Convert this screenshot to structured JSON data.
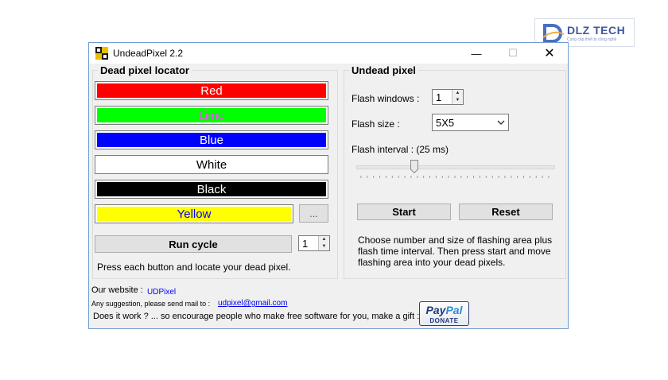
{
  "watermark": {
    "brand": "DLZ TECH",
    "tagline": "Cung cấp thiết bị công nghệ"
  },
  "window": {
    "title": "UndeadPixel 2.2",
    "minimize": "—",
    "maximize": "☐",
    "close": "✕"
  },
  "locator": {
    "group_title": "Dead pixel locator",
    "colors": [
      {
        "label": "Red",
        "bg": "#ff0000",
        "fg": "#ffffff"
      },
      {
        "label": "Lime",
        "bg": "#00ff00",
        "fg": "#ff44ff"
      },
      {
        "label": "Blue",
        "bg": "#0000ff",
        "fg": "#ffffff"
      },
      {
        "label": "White",
        "bg": "#ffffff",
        "fg": "#000000"
      },
      {
        "label": "Black",
        "bg": "#000000",
        "fg": "#ffffff"
      },
      {
        "label": "Yellow",
        "bg": "#ffff00",
        "fg": "#0000ff"
      }
    ],
    "custom_color_button": "...",
    "run_cycle_button": "Run cycle",
    "cycle_count": "1",
    "hint": "Press each button and locate your dead pixel."
  },
  "undead": {
    "group_title": "Undead pixel",
    "flash_windows_label": "Flash windows :",
    "flash_windows_value": "1",
    "flash_size_label": "Flash size :",
    "flash_size_value": "5X5",
    "flash_interval_label": "Flash interval : (25 ms)",
    "flash_interval_level": 0.29,
    "start_button": "Start",
    "reset_button": "Reset",
    "description_lines": [
      "Choose number and size of flashing area plus",
      "flash time interval. Then press start and move",
      "flashing area into your dead pixels."
    ]
  },
  "footer": {
    "website_label": "Our website :",
    "website_link": "UDPixel",
    "mail_label": "Any suggestion, please send mail to :",
    "mail_link": "udpixel@gmail.com",
    "gift_text": "Does it work ? ... so encourage people who make free software for you, make a gift :",
    "paypal_main_a": "Pay",
    "paypal_main_b": "Pal",
    "paypal_sub": "DONATE"
  },
  "colors": {
    "window_border": "#6f9bd1",
    "link": "#0000ee",
    "dialog_bg": "#f0f0f0"
  }
}
